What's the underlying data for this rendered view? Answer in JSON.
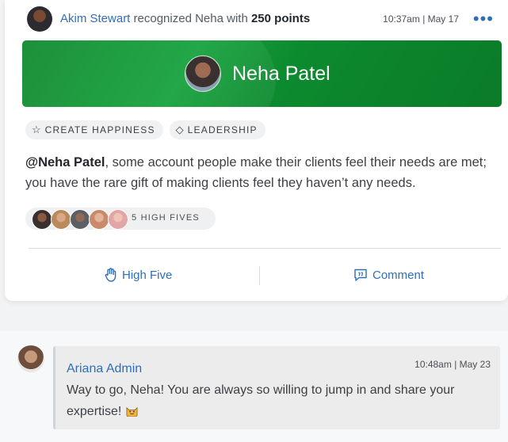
{
  "post": {
    "actor": "Akim Stewart",
    "verb": "recognized Neha with",
    "points": "250 points",
    "time": "10:37am | May 17",
    "more_icon": "more-dots-icon",
    "more_label": "•••"
  },
  "banner": {
    "recipient": "Neha Patel",
    "color": "#0f8a2e"
  },
  "tags": [
    {
      "icon": "star-icon",
      "glyph": "☆",
      "label": "CREATE HAPPINESS"
    },
    {
      "icon": "diamond-icon",
      "glyph": "◇",
      "label": "LEADERSHIP"
    }
  ],
  "message": {
    "mention": "@Neha Patel",
    "text": ", some account people make their clients feel their needs are met; you have the rare gift of making clients feel they haven’t any needs."
  },
  "high_fives": {
    "count_label": "5 HIGH FIVES"
  },
  "actions": {
    "high_five_label": "High Five",
    "comment_label": "Comment"
  },
  "comment": {
    "author": "Ariana Admin",
    "time": "10:48am | May 23",
    "text": "Way to go, Neha! You are always so willing to jump in and share your expertise!",
    "emoji_icon": "smiling-cat-icon"
  },
  "colors": {
    "link_blue": "#2f6fb7",
    "banner_green": "#0f8a2e"
  }
}
